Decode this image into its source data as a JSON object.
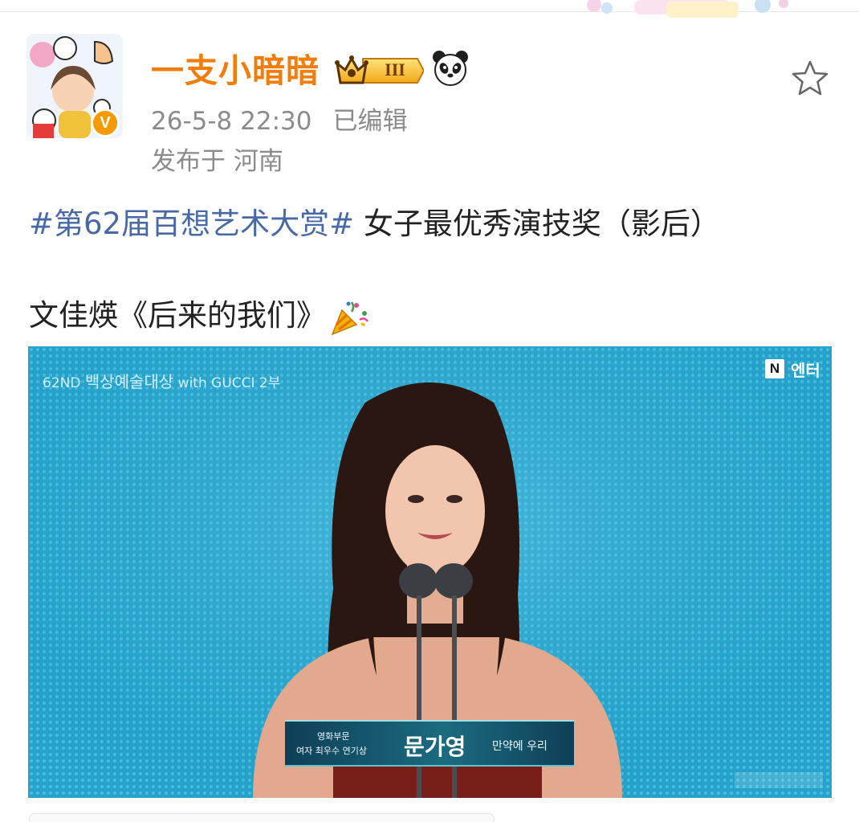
{
  "post": {
    "username": "一支小暗暗",
    "level_badge": "III",
    "timestamp": "26-5-8 22:30",
    "edited": "已编辑",
    "location": "发布于 河南",
    "hashtag": "#第62届百想艺术大赏#",
    "headline_rest": " 女子最优秀演技奖（影后）",
    "winner_line": "文佳煐《后来的我们》"
  },
  "avatar": {
    "badge_letter": "V"
  },
  "media": {
    "broadcast_edition": "62ND",
    "broadcast_title": "백상예술대상",
    "broadcast_sponsor": "with GUCCI",
    "broadcast_part": "2부",
    "network_letter": "N",
    "network_label": "엔터",
    "caption_category_1": "영화부문",
    "caption_category_2": "여자 최우수 연기상",
    "caption_name": "문가영",
    "caption_film": "만약에 우리"
  },
  "icons": {
    "favorite": "star-outline-icon",
    "verified": "verified-v-icon",
    "crown": "crown-icon",
    "panda": "panda-emoji-icon",
    "party": "party-popper-emoji-icon"
  },
  "colors": {
    "username": "#f27d0c",
    "hashtag": "#4869a6",
    "meta": "#8b8b8b",
    "badge": "#f59a00",
    "stage": "#27a6cc"
  }
}
